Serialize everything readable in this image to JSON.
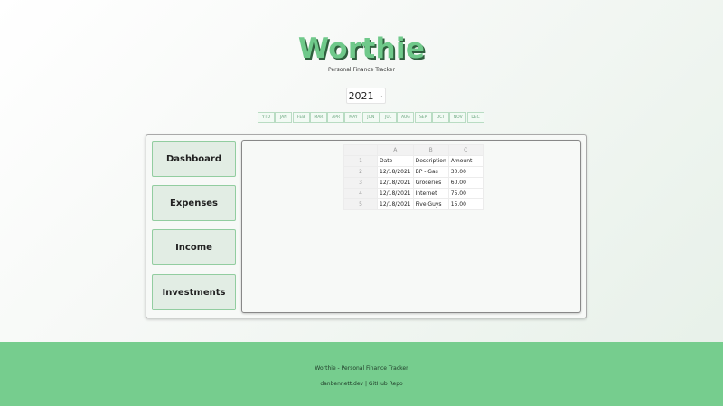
{
  "app": {
    "title": "Worthie",
    "tagline": "Personal Finance Tracker"
  },
  "year": {
    "selected": "2021"
  },
  "months": [
    "YTD",
    "JAN",
    "FEB",
    "MAR",
    "APR",
    "MAY",
    "JUN",
    "JUL",
    "AUG",
    "SEP",
    "OCT",
    "NOV",
    "DEC"
  ],
  "nav": [
    {
      "label": "Dashboard"
    },
    {
      "label": "Expenses"
    },
    {
      "label": "Income"
    },
    {
      "label": "Investments"
    }
  ],
  "sheet": {
    "columns": [
      "A",
      "B",
      "C"
    ],
    "rows": [
      {
        "num": "1",
        "cells": [
          "Date",
          "Description",
          "Amount"
        ]
      },
      {
        "num": "2",
        "cells": [
          "12/18/2021",
          "BP - Gas",
          "30.00"
        ]
      },
      {
        "num": "3",
        "cells": [
          "12/18/2021",
          "Groceries",
          "60.00"
        ]
      },
      {
        "num": "4",
        "cells": [
          "12/18/2021",
          "Internet",
          "75.00"
        ]
      },
      {
        "num": "5",
        "cells": [
          "12/18/2021",
          "Five Guys",
          "15.00"
        ]
      }
    ]
  },
  "footer": {
    "line1": "Worthie - Personal Finance Tracker",
    "site": "danbennett.dev",
    "separator": " | ",
    "repo": "GitHub Repo"
  },
  "colors": {
    "accent": "#76cd8e",
    "logo": "#6fc98a",
    "logo_shadow": "#2f5f3e"
  }
}
